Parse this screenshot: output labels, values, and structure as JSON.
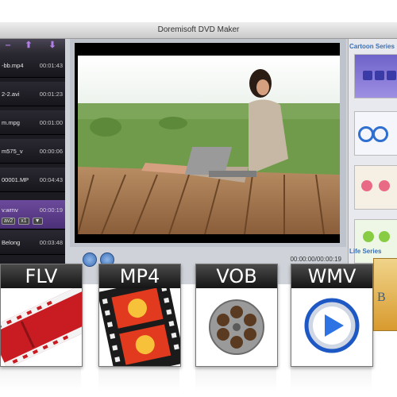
{
  "window": {
    "title": "Doremisoft DVD Maker"
  },
  "files": [
    {
      "name": "-bb.mp4",
      "duration": "00:01:43"
    },
    {
      "name": "2-2.avi",
      "duration": "00:01:23"
    },
    {
      "name": "m.mpg",
      "duration": "00:01:00"
    },
    {
      "name": "m575_v",
      "duration": "00:00:06"
    },
    {
      "name": "00001.MP",
      "duration": "00:04:43"
    },
    {
      "name": "v.wmv",
      "duration": "00:00:19"
    },
    {
      "name": "Belong",
      "duration": "00:03:48"
    }
  ],
  "selected_file_chips": [
    "av2",
    "x1",
    "▼"
  ],
  "player": {
    "time": "00:00:00/00:00:19"
  },
  "right_panel": {
    "cartoon_label": "Cartoon Series",
    "life_label": "Life Series"
  },
  "formats": [
    {
      "label": "FLV",
      "icon": "flv-film-icon"
    },
    {
      "label": "MP4",
      "icon": "mp4-film-icon"
    },
    {
      "label": "VOB",
      "icon": "vob-reel-icon"
    },
    {
      "label": "WMV",
      "icon": "wmv-play-icon"
    }
  ],
  "colors": {
    "accent": "#3a6fb7",
    "selected": "#6c4a9c",
    "sidebar": "#1c1b22"
  }
}
